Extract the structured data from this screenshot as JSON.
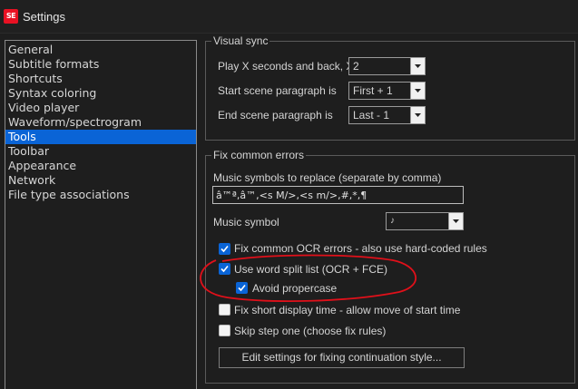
{
  "window": {
    "title": "Settings",
    "app_icon": "SE"
  },
  "nav": {
    "items": [
      {
        "label": "General",
        "selected": false
      },
      {
        "label": "Subtitle formats",
        "selected": false
      },
      {
        "label": "Shortcuts",
        "selected": false
      },
      {
        "label": "Syntax coloring",
        "selected": false
      },
      {
        "label": "Video player",
        "selected": false
      },
      {
        "label": "Waveform/spectrogram",
        "selected": false
      },
      {
        "label": "Tools",
        "selected": true
      },
      {
        "label": "Toolbar",
        "selected": false
      },
      {
        "label": "Appearance",
        "selected": false
      },
      {
        "label": "Network",
        "selected": false
      },
      {
        "label": "File type associations",
        "selected": false
      }
    ]
  },
  "visual_sync": {
    "title": "Visual sync",
    "play_label": "Play X seconds and back, X is",
    "play_value": "2",
    "start_label": "Start scene paragraph is",
    "start_value": "First + 1",
    "end_label": "End scene paragraph is",
    "end_value": "Last - 1"
  },
  "fix_common_errors": {
    "title": "Fix common errors",
    "music_symbols_label": "Music symbols to replace (separate by comma)",
    "music_symbols_value": "â™ª,â™,<s M/>,<s m/>,#,*,¶",
    "music_symbol_label": "Music symbol",
    "music_symbol_value": "♪",
    "checkboxes": [
      {
        "label": "Fix common OCR errors - also use hard-coded rules",
        "checked": true
      },
      {
        "label": "Use word split list (OCR + FCE)",
        "checked": true
      },
      {
        "label": "Avoid propercase",
        "checked": true
      },
      {
        "label": "Fix short display time - allow move of start time",
        "checked": false
      },
      {
        "label": "Skip step one (choose fix rules)",
        "checked": false
      }
    ],
    "edit_button": "Edit settings for fixing continuation style..."
  },
  "colors": {
    "accent": "#0a64d6",
    "annotation": "#e0101a",
    "background": "#1e1e1e"
  }
}
